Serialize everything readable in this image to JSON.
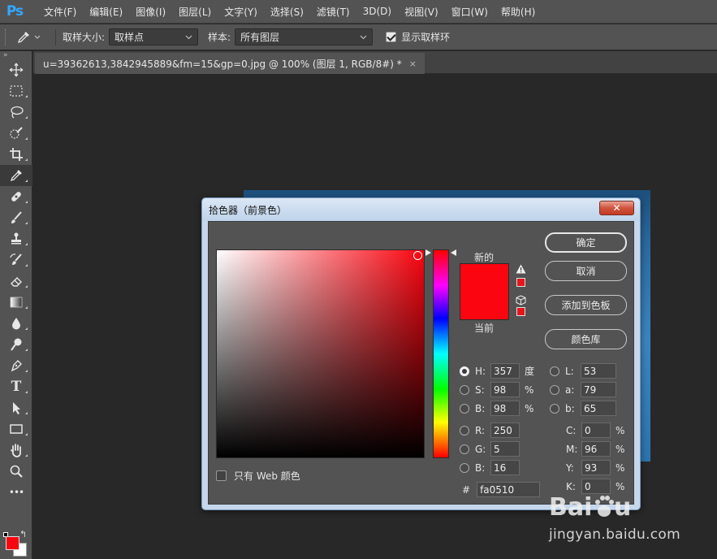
{
  "app": {
    "logo": "Ps"
  },
  "menu": [
    "文件(F)",
    "编辑(E)",
    "图像(I)",
    "图层(L)",
    "文字(Y)",
    "选择(S)",
    "滤镜(T)",
    "3D(D)",
    "视图(V)",
    "窗口(W)",
    "帮助(H)"
  ],
  "options": {
    "sample_size_label": "取样大小:",
    "sample_size_value": "取样点",
    "sample_label": "样本:",
    "sample_value": "所有图层",
    "show_ring_label": "显示取样环",
    "show_ring_checked": true
  },
  "document": {
    "tab_title": "u=39362613,3842945889&fm=15&gp=0.jpg @ 100% (图层 1, RGB/8#) *",
    "close": "×"
  },
  "toolbar": {
    "head": "»",
    "tools": [
      "move-tool",
      "marquee-tool",
      "lasso-tool",
      "quick-select-tool",
      "crop-tool",
      "eyedropper-tool",
      "healing-tool",
      "brush-tool",
      "stamp-tool",
      "history-brush-tool",
      "eraser-tool",
      "gradient-tool",
      "blur-tool",
      "dodge-tool",
      "pen-tool",
      "type-tool",
      "path-select-tool",
      "rectangle-tool",
      "hand-tool",
      "zoom-tool",
      "more-tools"
    ],
    "active": "eyedropper-tool",
    "type_glyph": "T",
    "more_glyph": "•••"
  },
  "dialog": {
    "title": "拾色器（前景色）",
    "close": "✕",
    "new_label": "新的",
    "current_label": "当前",
    "new_color": "#fa0510",
    "current_color": "#fa0510",
    "buttons": {
      "ok": "确定",
      "cancel": "取消",
      "add_swatch": "添加到色板",
      "libraries": "颜色库"
    },
    "web_only_label": "只有 Web 颜色",
    "hsb": {
      "H": {
        "label": "H:",
        "value": "357",
        "unit": "度",
        "selected": true
      },
      "S": {
        "label": "S:",
        "value": "98",
        "unit": "%"
      },
      "B": {
        "label": "B:",
        "value": "98",
        "unit": "%"
      }
    },
    "rgb": {
      "R": {
        "label": "R:",
        "value": "250"
      },
      "G": {
        "label": "G:",
        "value": "5"
      },
      "B": {
        "label": "B:",
        "value": "16"
      }
    },
    "lab": {
      "L": {
        "label": "L:",
        "value": "53"
      },
      "a": {
        "label": "a:",
        "value": "79"
      },
      "b": {
        "label": "b:",
        "value": "65"
      }
    },
    "cmyk": {
      "C": {
        "label": "C:",
        "value": "0",
        "unit": "%"
      },
      "M": {
        "label": "M:",
        "value": "96",
        "unit": "%"
      },
      "Y": {
        "label": "Y:",
        "value": "93",
        "unit": "%"
      },
      "K": {
        "label": "K:",
        "value": "0",
        "unit": "%"
      }
    },
    "hex_label": "#",
    "hex_value": "fa0510"
  },
  "colors": {
    "foreground": "#fa0510",
    "background": "#ffffff",
    "swap_glyph": "↰"
  },
  "watermark": {
    "url": "jingyan.baidu.com"
  }
}
